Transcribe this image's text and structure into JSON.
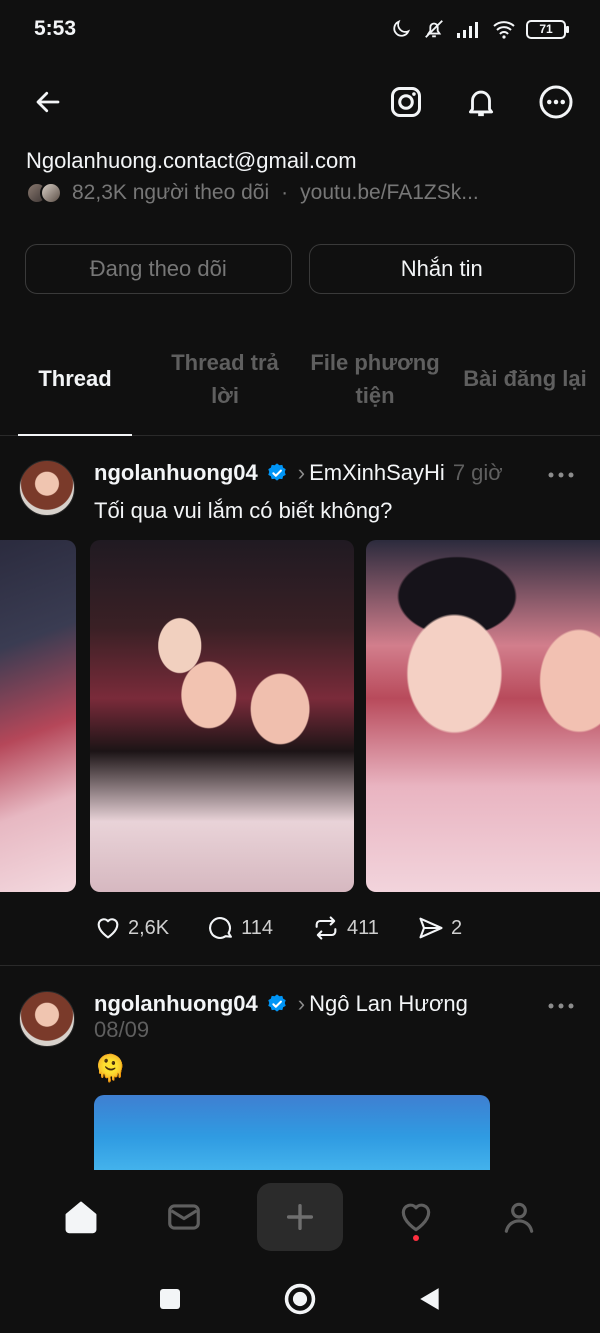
{
  "status_bar": {
    "time": "5:53",
    "battery": "71"
  },
  "profile": {
    "bio": "Ngolanhuong.contact@gmail.com",
    "followers": "82,3K người theo dõi",
    "separator": "·",
    "link": "youtu.be/FA1ZSk..."
  },
  "actions": {
    "following": "Đang theo dõi",
    "message": "Nhắn tin"
  },
  "tabs": [
    {
      "label": "Thread"
    },
    {
      "label": "Thread trả lời"
    },
    {
      "label": "File phương tiện"
    },
    {
      "label": "Bài đăng lại"
    }
  ],
  "posts": [
    {
      "author": "ngolanhuong04",
      "reply_to": "EmXinhSayHi",
      "time": "7 giờ",
      "text": "Tối qua vui lắm có biết không?",
      "likes": "2,6K",
      "comments": "114",
      "reposts": "411",
      "shares": "2"
    },
    {
      "author": "ngolanhuong04",
      "reply_to": "Ngô Lan Hương",
      "time": "08/09",
      "text": "🫠"
    }
  ],
  "colors": {
    "background": "#101010",
    "text": "#f3f5f7",
    "muted": "#777777",
    "verified": "#0095f6",
    "notification": "#ff3040"
  },
  "icons": {
    "back": "arrow-left-icon",
    "instagram": "instagram-icon",
    "bell": "bell-icon",
    "more": "more-horizontal-icon",
    "home": "home-icon",
    "inbox": "inbox-icon",
    "create": "plus-icon",
    "activity": "heart-icon",
    "profile": "user-icon"
  }
}
